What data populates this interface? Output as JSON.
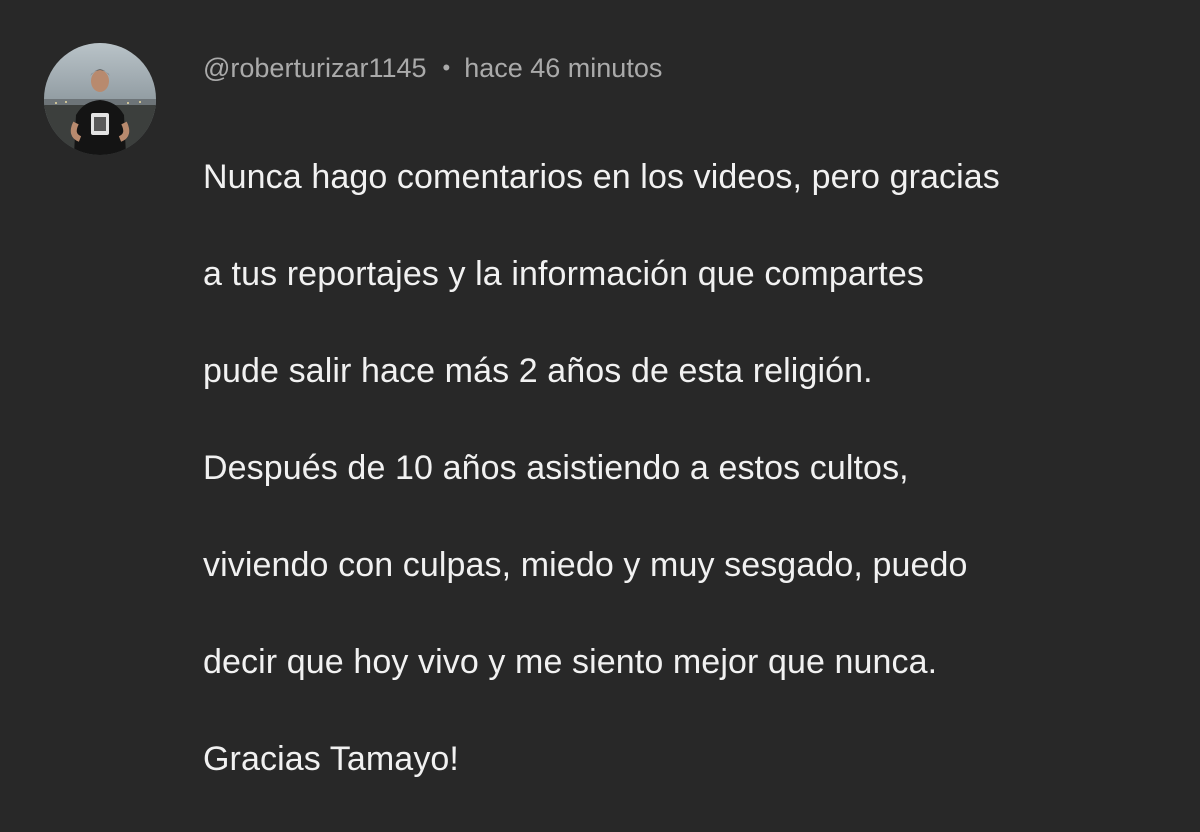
{
  "comment": {
    "author": "@roberturizar1145",
    "separator": "•",
    "timestamp": "hace 46 minutos",
    "avatar_icon": "user-photo-avatar",
    "text_lines": [
      "Nunca hago comentarios en los videos, pero gracias",
      "a tus reportajes y la información que compartes",
      "pude salir hace más 2 años de esta religión.",
      "Después de 10 años asistiendo a estos cultos,",
      "viviendo con culpas, miedo y muy sesgado, puedo",
      "decir que hoy vivo y me siento mejor que nunca.",
      "Gracias Tamayo!"
    ]
  },
  "colors": {
    "background": "#282828",
    "meta_text": "#aaaaaa",
    "body_text": "#f1f1f1"
  }
}
